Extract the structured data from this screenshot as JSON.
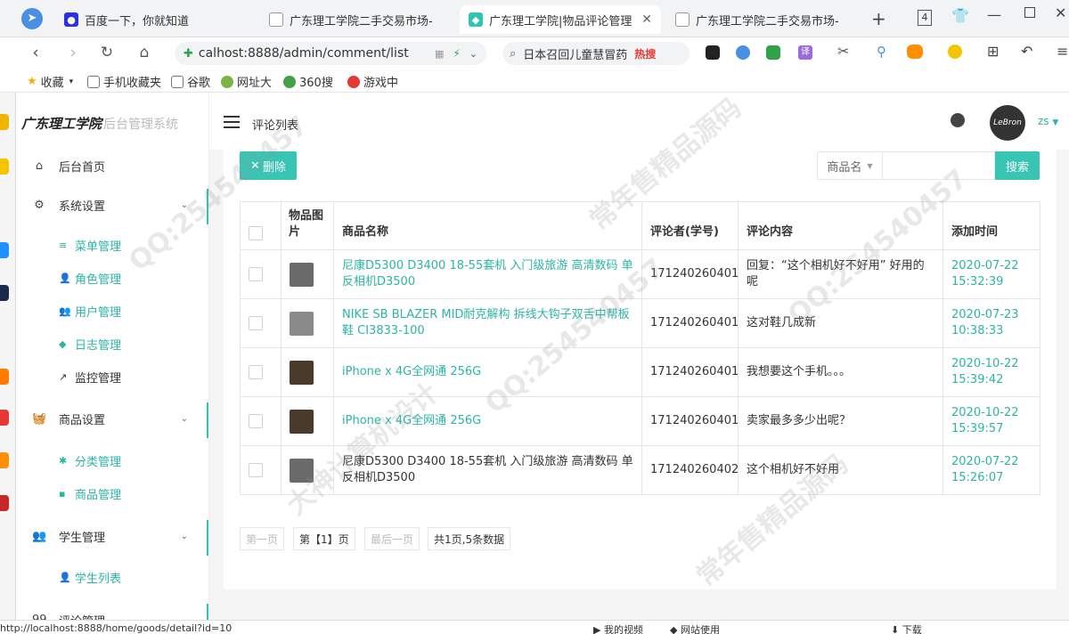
{
  "browser": {
    "tabs": [
      {
        "label": "百度一下，你就知道",
        "icon": "baidu-paw-icon",
        "active": false
      },
      {
        "label": "广东理工学院二手交易市场-",
        "icon": "page-icon",
        "active": false
      },
      {
        "label": "广东理工学院|物品评论管理",
        "icon": "diamond-icon",
        "active": true
      },
      {
        "label": "广东理工学院二手交易市场-",
        "icon": "page-icon",
        "active": false
      }
    ],
    "tab_count": "4",
    "url": "calhost:8888/admin/comment/list",
    "search_text": "日本召回儿童慧冒药",
    "search_badge": "热搜",
    "bookmarks": [
      "收藏",
      "手机收藏夹",
      "谷歌",
      "网址大",
      "360搜",
      "游戏中"
    ]
  },
  "sidebar": {
    "brand": "广东理工学院",
    "brand_sub": "后台管理系统",
    "home": "后台首页",
    "groups": [
      {
        "label": "系统设置",
        "items": [
          "菜单管理",
          "角色管理",
          "用户管理",
          "日志管理",
          "监控管理"
        ]
      },
      {
        "label": "商品设置",
        "items": [
          "分类管理",
          "商品管理"
        ]
      },
      {
        "label": "学生管理",
        "items": [
          "学生列表"
        ]
      },
      {
        "label": "评论管理",
        "items": []
      }
    ]
  },
  "header": {
    "breadcrumb": "评论列表",
    "username": "zs",
    "avatar_text": "LeBron"
  },
  "toolbar": {
    "delete_label": "删除",
    "search_select": "商品名",
    "search_placeholder": "",
    "search_button": "搜索"
  },
  "table": {
    "columns": [
      "物品图片",
      "商品名称",
      "评论者(学号)",
      "评论内容",
      "添加时间"
    ],
    "rows": [
      {
        "name": "尼康D5300 D3400 18-55套机 入门级旅游 高清数码 单反相机D3500",
        "name_link": true,
        "student": "171240260401",
        "content": "回复：“这个相机好不好用” 好用的呢",
        "date": "2020-07-22",
        "time": "15:32:39"
      },
      {
        "name": "NIKE SB BLAZER MID耐克解构 拆线大钩子双舌中帮板鞋 CI3833-100",
        "name_link": true,
        "student": "171240260401",
        "content": "这对鞋几成新",
        "date": "2020-07-23",
        "time": "10:38:33"
      },
      {
        "name": "iPhone x 4G全网通 256G",
        "name_link": true,
        "student": "171240260401",
        "content": "我想要这个手机。。。",
        "date": "2020-10-22",
        "time": "15:39:42"
      },
      {
        "name": "iPhone x 4G全网通 256G",
        "name_link": true,
        "student": "171240260401",
        "content": "卖家最多多少出呢？",
        "date": "2020-10-22",
        "time": "15:39:57"
      },
      {
        "name": "尼康D5300 D3400 18-55套机 入门级旅游 高清数码 单反相机D3500",
        "name_link": false,
        "student": "171240260402",
        "content": "这个相机好不好用",
        "date": "2020-07-22",
        "time": "15:26:07"
      }
    ]
  },
  "pagination": {
    "first": "第一页",
    "current": "第【1】页",
    "last": "最后一页",
    "summary": "共1页,5条数据"
  },
  "status_bar": {
    "url_hint": "http://localhost:8888/home/goods/detail?id=10",
    "items": [
      "我的视频",
      "网站使用",
      "下载"
    ]
  },
  "watermarks": [
    "QQ:254540457",
    "大神计算机设计",
    "常年售精品源码"
  ]
}
